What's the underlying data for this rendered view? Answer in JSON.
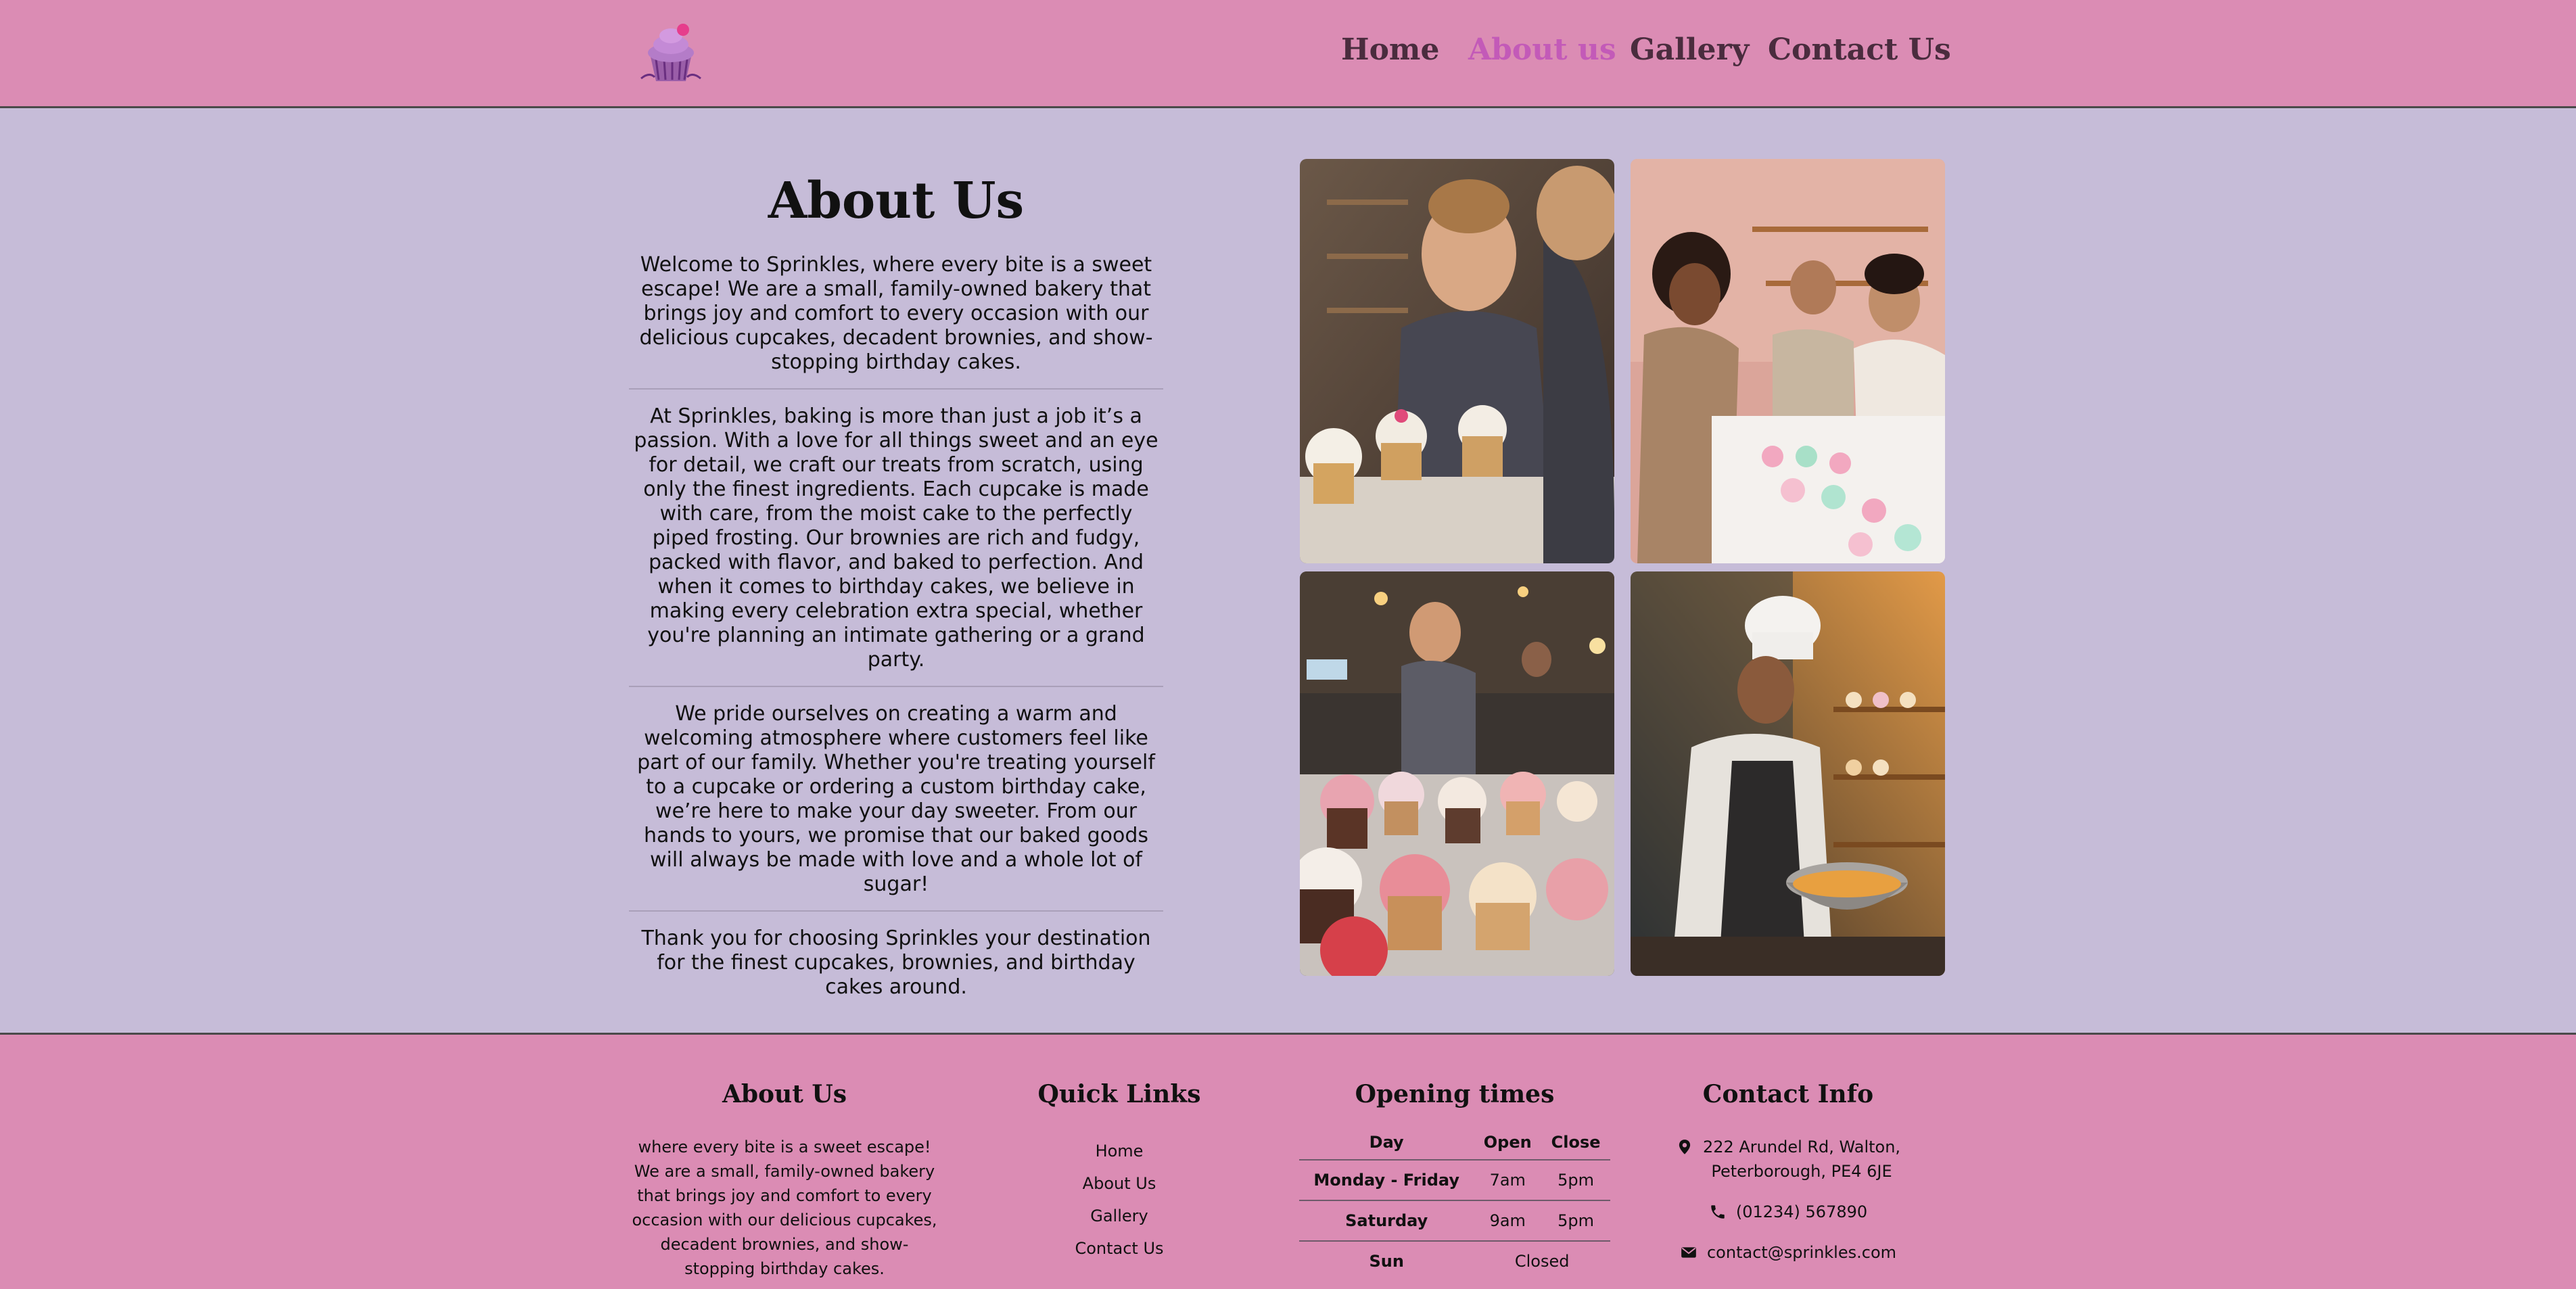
{
  "header": {
    "logo_name": "cupcake-logo",
    "nav": [
      {
        "label": "Home",
        "active": false
      },
      {
        "label": "About us",
        "active": true
      },
      {
        "label": "Gallery",
        "active": false
      },
      {
        "label": "Contact Us",
        "active": false
      }
    ]
  },
  "about": {
    "title": "About Us",
    "paragraphs": [
      "Welcome to Sprinkles, where every bite is a sweet escape! We are a small, family-owned bakery that brings joy and comfort to every occasion with our delicious cupcakes, decadent brownies, and show-stopping birthday cakes.",
      "At Sprinkles, baking is more than just a job it’s a passion. With a love for all things sweet and an eye for detail, we craft our treats from scratch, using only the finest ingredients. Each cupcake is made with care, from the moist cake to the perfectly piped frosting. Our brownies are rich and fudgy, packed with flavor, and baked to perfection. And when it comes to birthday cakes, we believe in making every celebration extra special, whether you're planning an intimate gathering or a grand party.",
      "We pride ourselves on creating a warm and welcoming atmosphere where customers feel like part of our family. Whether you're treating yourself to a cupcake or ordering a custom birthday cake, we’re here to make your day sweeter. From our hands to yours, we promise that our baked goods will always be made with love and a whole lot of sugar!",
      "Thank you for choosing Sprinkles your destination for the finest cupcakes, brownies, and birthday cakes around."
    ]
  },
  "gallery_photos": [
    "photo-baker-decorating-cupcakes",
    "photo-team-at-cupcake-counter",
    "photo-cupcakes-in-bakery",
    "photo-chef-mixing-bowl"
  ],
  "footer": {
    "about": {
      "title": "About Us",
      "text": "where every bite is a sweet escape! We are a small, family-owned bakery that brings joy and comfort to every occasion with our delicious cupcakes, decadent brownies, and show-stopping birthday cakes."
    },
    "quick_links": {
      "title": "Quick Links",
      "links": [
        "Home",
        "About Us",
        "Gallery",
        "Contact Us"
      ]
    },
    "opening": {
      "title": "Opening times",
      "headers": [
        "Day",
        "Open",
        "Close"
      ],
      "rows": [
        {
          "day": "Monday - Friday",
          "open": "7am",
          "close": "5pm"
        },
        {
          "day": "Saturday",
          "open": "9am",
          "close": "5pm"
        },
        {
          "day": "Sun",
          "closed": "Closed"
        }
      ]
    },
    "contact": {
      "title": "Contact Info",
      "address_line1": "222 Arundel Rd, Walton,",
      "address_line2": "Peterborough, PE4 6JE",
      "phone": "(01234) 567890",
      "email": "contact@sprinkles.com"
    }
  },
  "colors": {
    "header_bg": "#db8cb4",
    "page_bg": "#c6bcd8",
    "nav_text": "#4a2c3e",
    "nav_active": "#c35ab8"
  }
}
